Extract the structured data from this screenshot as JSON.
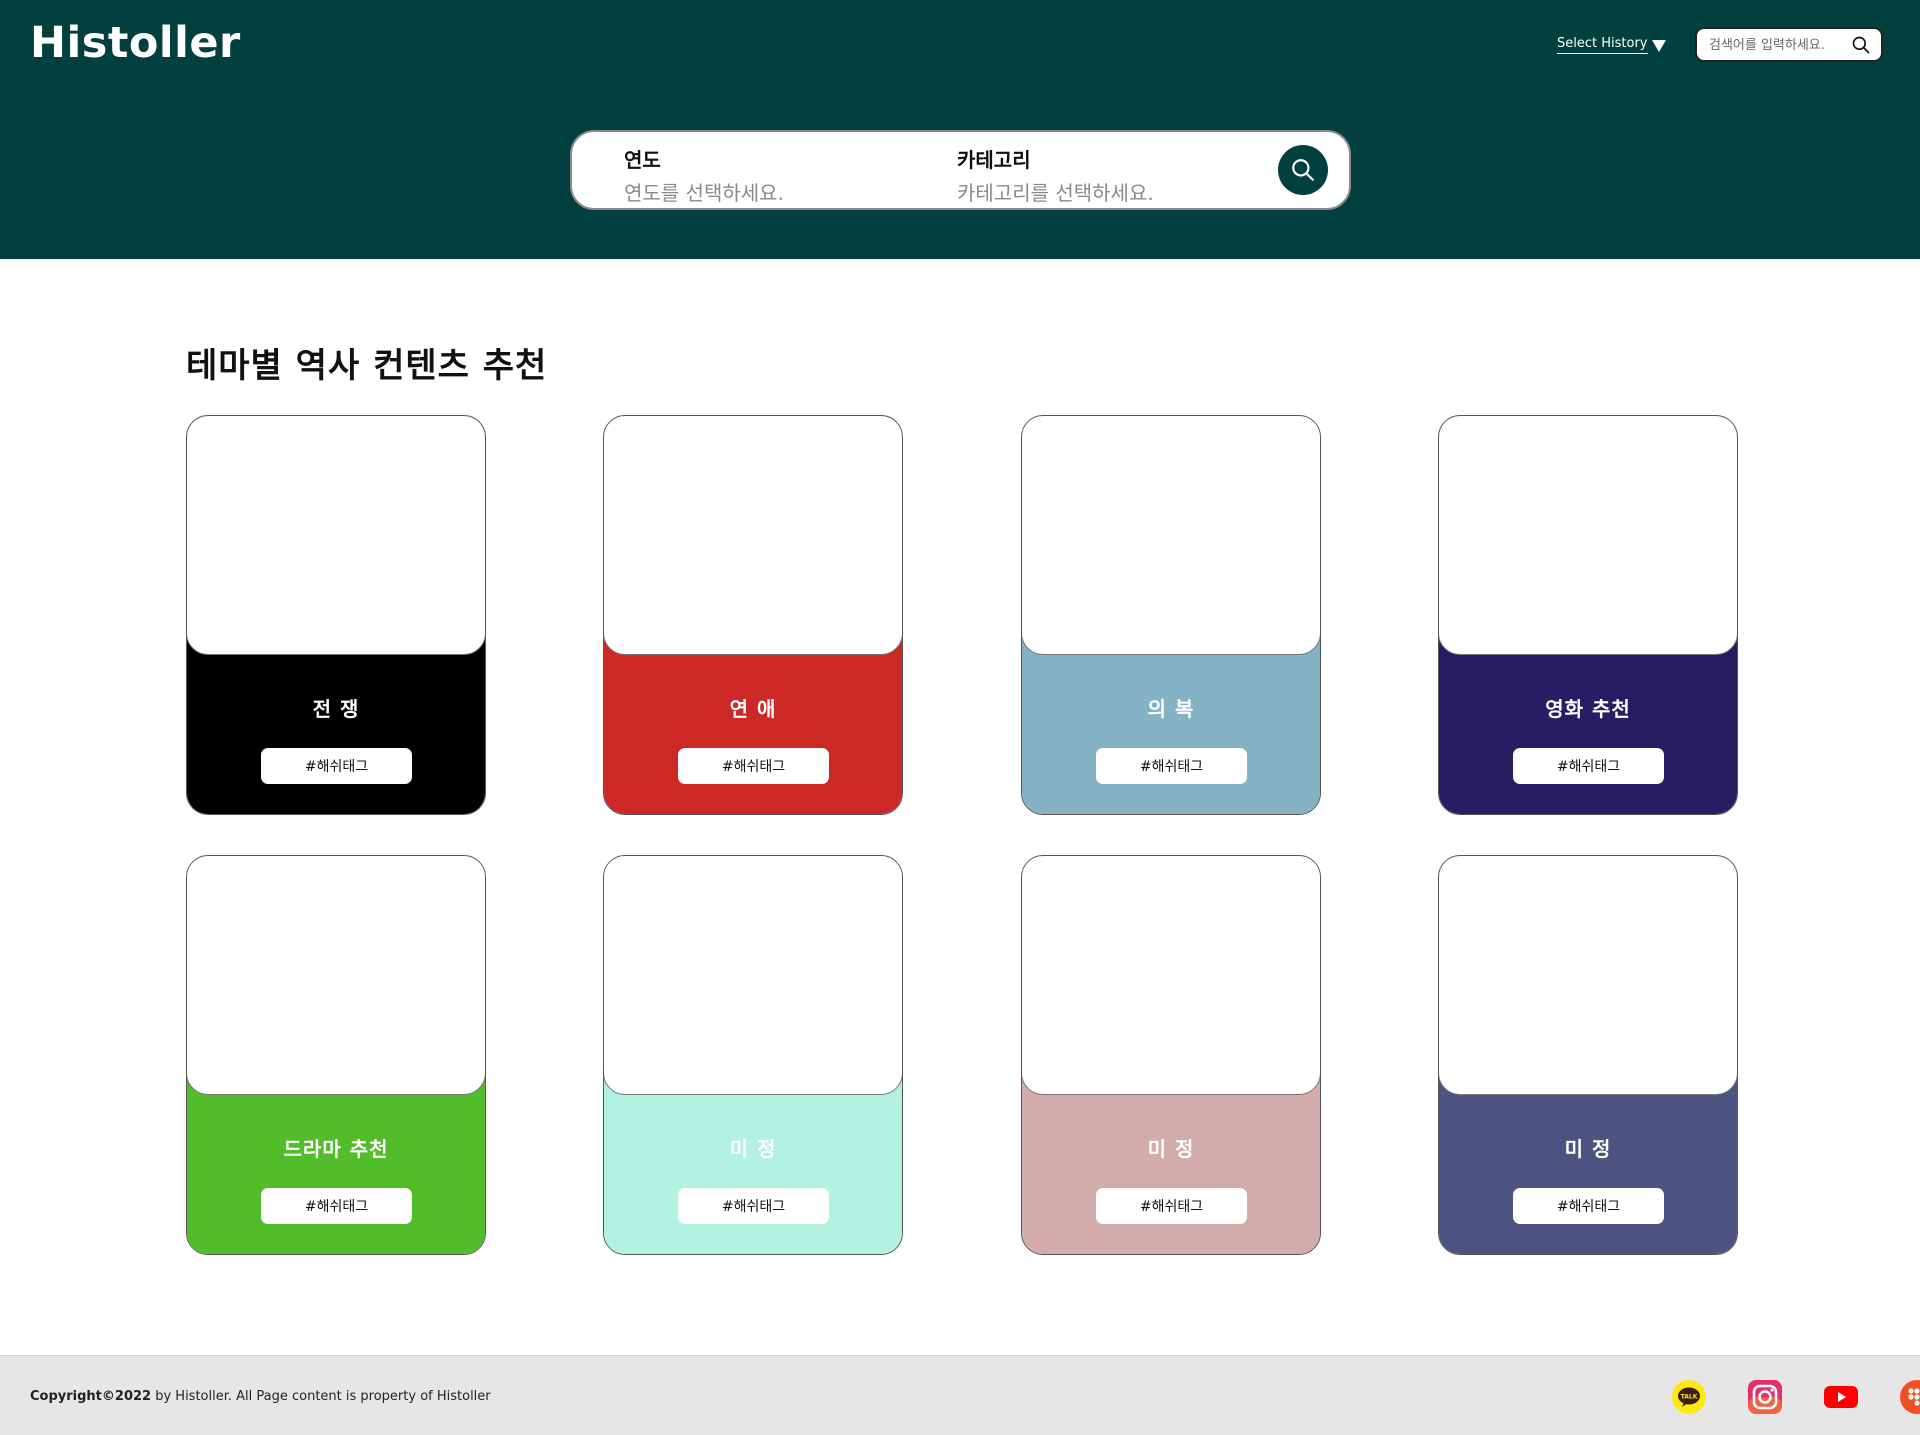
{
  "header": {
    "logo": "Histoller",
    "select_history": "Select History",
    "search_placeholder": "검색어를 입력하세요."
  },
  "hero_search": {
    "year_title": "연도",
    "year_placeholder": "연도를 선택하세요.",
    "category_title": "카테고리",
    "category_placeholder": "카테고리를 선택하세요."
  },
  "main": {
    "section_title": "테마별 역사 컨텐츠 추천",
    "cards": [
      {
        "name": "전 쟁",
        "tag": "#해쉬태그",
        "color": "#000000"
      },
      {
        "name": "연 애",
        "tag": "#해쉬태그",
        "color": "#cc2926"
      },
      {
        "name": "의 복",
        "tag": "#해쉬태그",
        "color": "#86b2c5"
      },
      {
        "name": "영화 추천",
        "tag": "#해쉬태그",
        "color": "#281c62"
      },
      {
        "name": "드라마 추천",
        "tag": "#해쉬태그",
        "color": "#52bc2a"
      },
      {
        "name": "미 정",
        "tag": "#해쉬태그",
        "color": "#b3f2e0"
      },
      {
        "name": "미 정",
        "tag": "#해쉬태그",
        "color": "#d4abab"
      },
      {
        "name": "미 정",
        "tag": "#해쉬태그",
        "color": "#4c5380"
      }
    ]
  },
  "footer": {
    "copyright_bold": "Copyright©2022",
    "copyright_rest": " by Histoller. All Page content is property of Histoller",
    "socials": [
      {
        "icon": "kakaotalk-icon",
        "label": "TALK",
        "color": "#ffe812"
      },
      {
        "icon": "instagram-icon",
        "color": "#e1306c"
      },
      {
        "icon": "youtube-icon",
        "color": "#ff0000"
      },
      {
        "icon": "twitch-like-icon",
        "color": "#f04e23"
      }
    ]
  },
  "colors": {
    "header_bg": "#023f3f",
    "footer_bg": "#e6e6e6"
  }
}
